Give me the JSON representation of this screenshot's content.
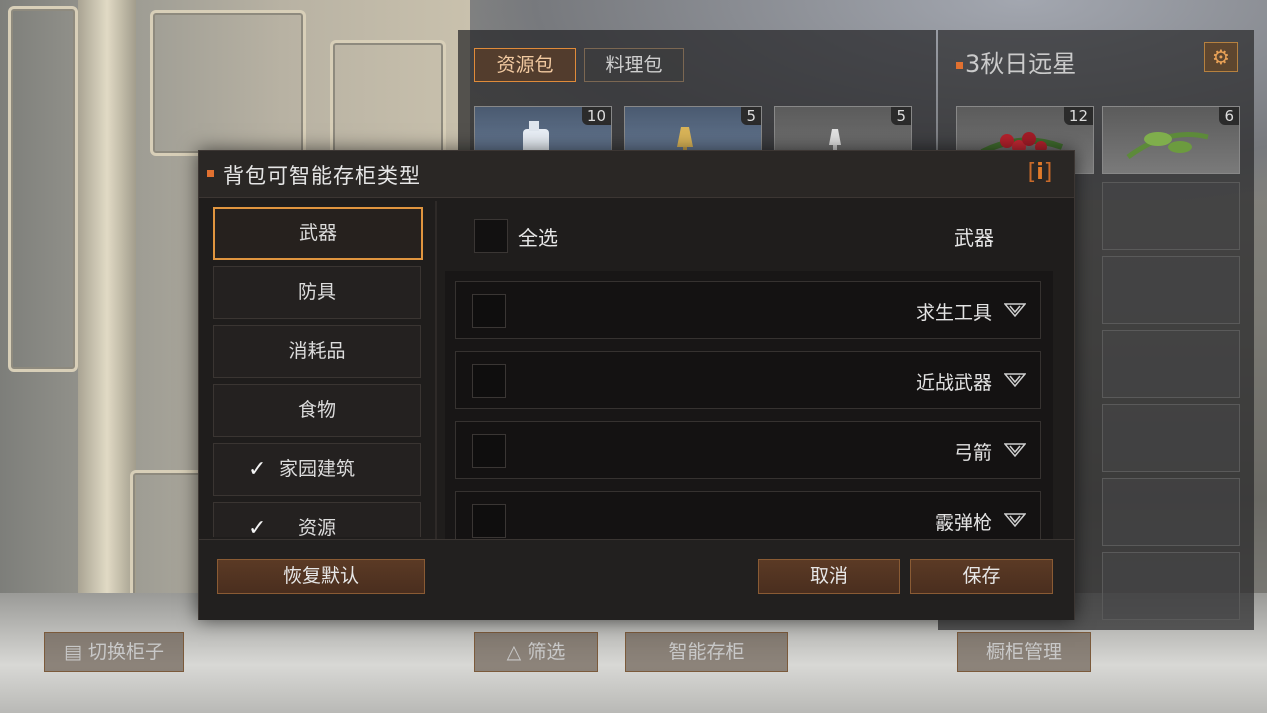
{
  "inventory": {
    "tabs": [
      "资源包",
      "料理包"
    ],
    "left_slots": [
      {
        "count": "10",
        "icon": "jerrycan-icon"
      },
      {
        "count": "5",
        "icon": "lamp-icon"
      },
      {
        "count": "5",
        "icon": "lamp-icon"
      }
    ],
    "right_title": "3秋日远星",
    "right_slots": [
      {
        "count": "12",
        "icon": "berries-icon"
      },
      {
        "count": "6",
        "icon": "herb-icon"
      }
    ]
  },
  "bottom_bar": {
    "switch_cabinet": "切换柜子",
    "filter": "筛选",
    "smart_store": "智能存柜",
    "cabinet_manage": "橱柜管理"
  },
  "dialog": {
    "title": "背包可智能存柜类型",
    "info_label": "i",
    "categories": [
      {
        "label": "武器",
        "checked": false,
        "active": true
      },
      {
        "label": "防具",
        "checked": false,
        "active": false
      },
      {
        "label": "消耗品",
        "checked": false,
        "active": false
      },
      {
        "label": "食物",
        "checked": false,
        "active": false
      },
      {
        "label": "家园建筑",
        "checked": true,
        "active": false
      },
      {
        "label": "资源",
        "checked": true,
        "active": false
      }
    ],
    "select_all_label": "全选",
    "current_category": "武器",
    "subcategories": [
      {
        "label": "求生工具"
      },
      {
        "label": "近战武器"
      },
      {
        "label": "弓箭"
      },
      {
        "label": "霰弹枪"
      }
    ],
    "reset_label": "恢复默认",
    "cancel_label": "取消",
    "save_label": "保存"
  },
  "colors": {
    "accent": "#e0953f",
    "dialog_bg": "#1f1d1c"
  }
}
